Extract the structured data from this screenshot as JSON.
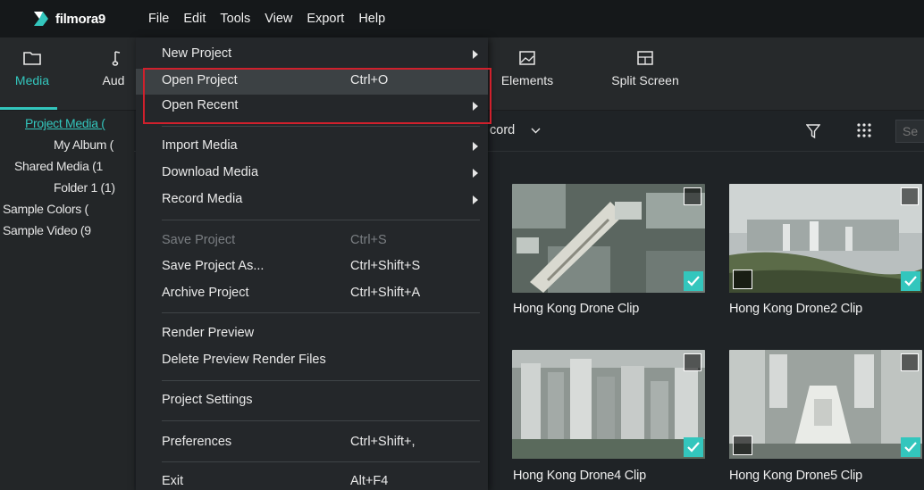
{
  "app": {
    "logo_text": "filmora9",
    "colors": {
      "accent": "#33c6bd",
      "highlight": "#d0202c",
      "background": "#1f2326"
    }
  },
  "menubar": {
    "items": [
      {
        "label": "File"
      },
      {
        "label": "Edit"
      },
      {
        "label": "Tools"
      },
      {
        "label": "View"
      },
      {
        "label": "Export"
      },
      {
        "label": "Help"
      }
    ]
  },
  "toolbar": {
    "media": {
      "label": "Media",
      "icon": "folder-icon"
    },
    "audio": {
      "label": "Aud",
      "icon": "music-note-icon"
    },
    "elements": {
      "label": "Elements",
      "icon": "image-icon"
    },
    "split_screen": {
      "label": "Split Screen",
      "icon": "split-screen-icon"
    }
  },
  "sidebar": {
    "items": [
      {
        "label": "Project Media ("
      },
      {
        "label": "My Album ("
      },
      {
        "label": "Shared Media (1"
      },
      {
        "label": "Folder 1 (1)"
      },
      {
        "label": "Sample Colors ("
      },
      {
        "label": "Sample Video (9"
      }
    ]
  },
  "filter": {
    "record_label": "cord",
    "search_placeholder": "Se"
  },
  "media_items": [
    {
      "caption": "Hong Kong Drone Clip"
    },
    {
      "caption": "Hong Kong Drone2 Clip"
    },
    {
      "caption": "Hong Kong Drone4 Clip"
    },
    {
      "caption": "Hong Kong Drone5 Clip"
    }
  ],
  "file_menu": {
    "new_project": {
      "label": "New Project"
    },
    "open_project": {
      "label": "Open Project",
      "shortcut": "Ctrl+O"
    },
    "open_recent": {
      "label": "Open Recent"
    },
    "import_media": {
      "label": "Import Media"
    },
    "download_media": {
      "label": "Download Media"
    },
    "record_media": {
      "label": "Record Media"
    },
    "save_project": {
      "label": "Save Project",
      "shortcut": "Ctrl+S"
    },
    "save_project_as": {
      "label": "Save Project As...",
      "shortcut": "Ctrl+Shift+S"
    },
    "archive_project": {
      "label": "Archive Project",
      "shortcut": "Ctrl+Shift+A"
    },
    "render_preview": {
      "label": "Render Preview"
    },
    "delete_preview": {
      "label": "Delete Preview Render Files"
    },
    "project_settings": {
      "label": "Project Settings"
    },
    "preferences": {
      "label": "Preferences",
      "shortcut": "Ctrl+Shift+,"
    },
    "exit": {
      "label": "Exit",
      "shortcut": "Alt+F4"
    }
  }
}
